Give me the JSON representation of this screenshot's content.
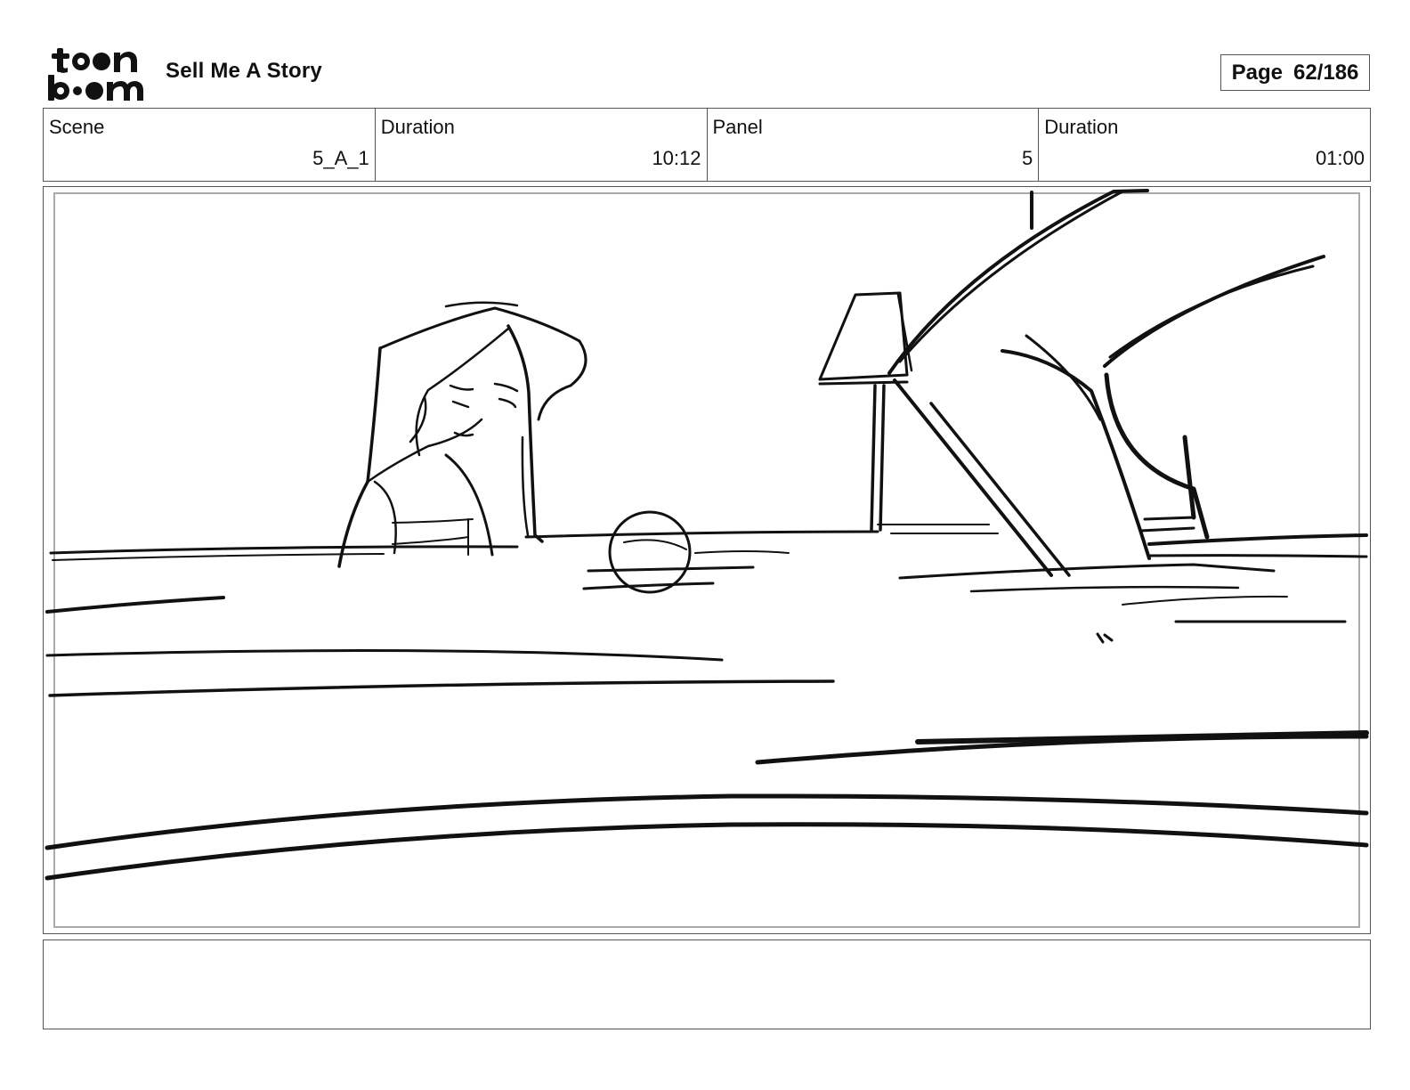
{
  "header": {
    "logo_text": "toon boom",
    "project_title": "Sell Me A Story",
    "page_label": "Page",
    "page_number": "62/186"
  },
  "info": {
    "scene_label": "Scene",
    "scene_value": "5_A_1",
    "scene_duration_label": "Duration",
    "scene_duration_value": "10:12",
    "panel_label": "Panel",
    "panel_value": "5",
    "panel_duration_label": "Duration",
    "panel_duration_value": "01:00"
  },
  "notes": {
    "text": ""
  }
}
